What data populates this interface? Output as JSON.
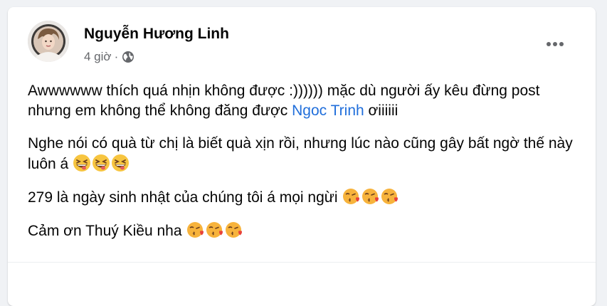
{
  "post": {
    "author": "Nguyễn Hương Linh",
    "time": "4 giờ",
    "separator": "·",
    "privacy_icon": "globe-icon",
    "more_icon": "more-horizontal-icon"
  },
  "content": {
    "p1_before": "Awwwwww thích quá nhịn không được :)))))) mặc dù người ấy kêu đừng post nhưng em không thể không đăng được ",
    "p1_mention": "Ngoc Trinh",
    "p1_after": " ơiiiiii",
    "p2_text": "Nghe nói có quà từ chị là biết quà xịn rồi, nhưng lúc nào cũng gây bất ngờ thế này luôn á",
    "p2_emojis": [
      "grinning-squinting-tongue-emoji",
      "grinning-squinting-tongue-emoji",
      "grinning-squinting-tongue-emoji"
    ],
    "p3_text": "279 là ngày sinh nhật của chúng tôi á mọi ngừi",
    "p3_emojis": [
      "face-blowing-kiss-emoji",
      "face-blowing-kiss-emoji",
      "face-blowing-kiss-emoji"
    ],
    "p4_text": "Cảm ơn Thuý Kiều nha",
    "p4_emojis": [
      "face-blowing-kiss-emoji",
      "face-blowing-kiss-emoji",
      "face-blowing-kiss-emoji"
    ]
  },
  "colors": {
    "mention": "#216fdb",
    "text": "#050505",
    "secondary": "#65676b",
    "background": "#f0f2f5"
  }
}
